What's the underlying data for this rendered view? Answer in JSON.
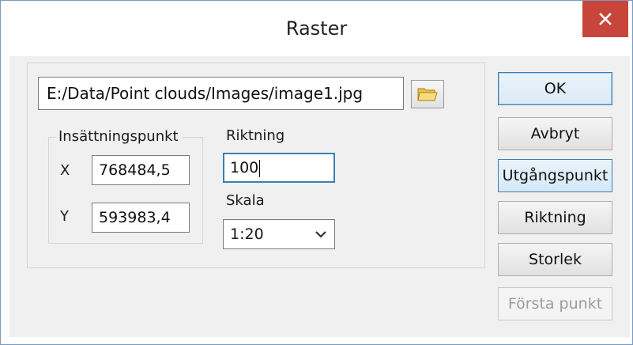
{
  "window": {
    "title": "Raster",
    "close_icon": "close-icon"
  },
  "file": {
    "path": "E:/Data/Point clouds/Images/image1.jpg",
    "browse_icon": "folder-icon"
  },
  "insertion_point": {
    "legend": "Insättningspunkt",
    "x_label": "X",
    "x_value": "768484,5",
    "y_label": "Y",
    "y_value": "593983,4"
  },
  "direction": {
    "label": "Riktning",
    "value": "100"
  },
  "scale": {
    "label": "Skala",
    "selected": "1:20"
  },
  "buttons": {
    "ok": "OK",
    "cancel": "Avbryt",
    "origin": "Utgångspunkt",
    "direction": "Riktning",
    "size": "Storlek",
    "first_point": "Första punkt"
  },
  "colors": {
    "close_bg": "#c7453a",
    "focus_border": "#3c7fb1",
    "dialog_bg": "#f0f0f0"
  }
}
